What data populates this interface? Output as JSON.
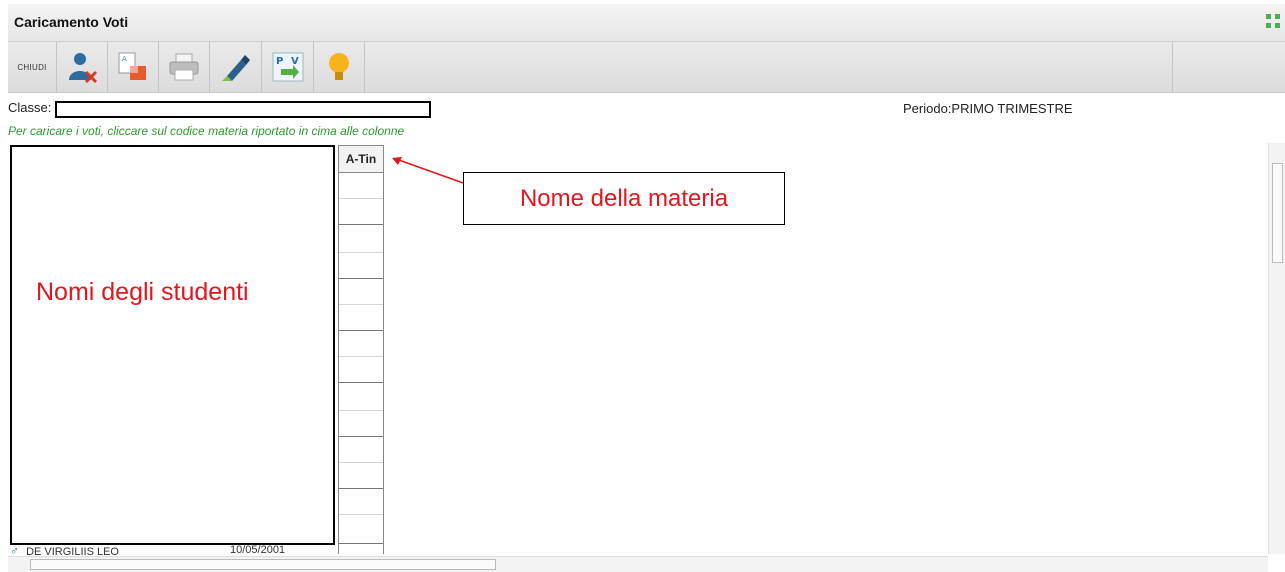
{
  "window": {
    "title": "Caricamento Voti"
  },
  "toolbar": {
    "close_label": "CHIUDI",
    "buttons": [
      {
        "icon": "user-delete-icon"
      },
      {
        "icon": "document-transfer-icon"
      },
      {
        "icon": "printer-icon"
      },
      {
        "icon": "brush-icon"
      },
      {
        "icon": "pv-transfer-icon"
      },
      {
        "icon": "lightbulb-icon"
      }
    ]
  },
  "form": {
    "class_label": "Classe:",
    "class_value": "",
    "periodo_label": "Periodo:PRIMO TRIMESTRE",
    "hint": "Per caricare i voti, cliccare sul codice materia riportato in cima alle colonne"
  },
  "grid": {
    "subject_column": "A-Tin",
    "students_annotation": "Nomi degli studenti",
    "partial_student_name": "DE VIRGILIIS LEO",
    "partial_student_date": "10/05/2001"
  },
  "annotation": {
    "subject_name": "Nome della materia"
  },
  "colors": {
    "annotation": "#e4161c",
    "hint": "#2e9b2e"
  }
}
